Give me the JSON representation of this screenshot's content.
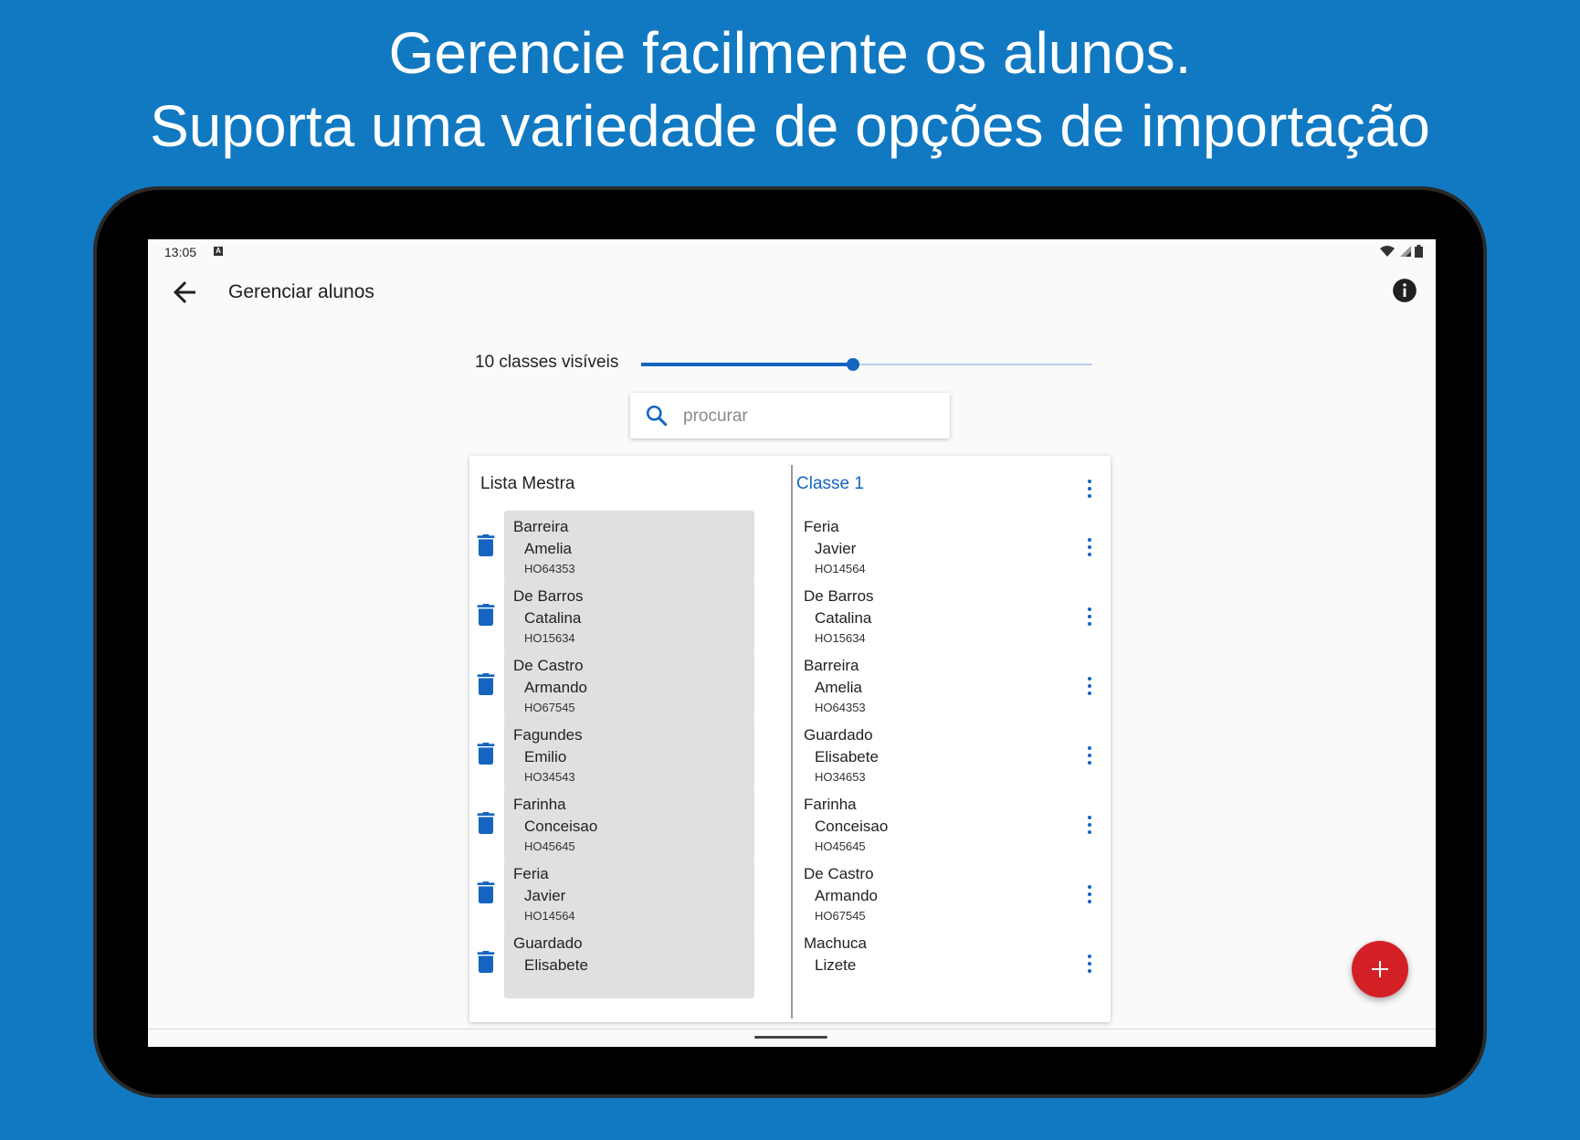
{
  "headline": {
    "line1": "Gerencie facilmente os alunos.",
    "line2": "Suporta uma variedade de opções de importação"
  },
  "status_bar": {
    "time": "13:05",
    "notification_letter": "A"
  },
  "toolbar": {
    "title": "Gerenciar alunos"
  },
  "slider": {
    "label": "10 classes visíveis",
    "value_fraction": 0.47
  },
  "search": {
    "placeholder": "procurar",
    "value": ""
  },
  "master_list": {
    "title": "Lista Mestra",
    "students": [
      {
        "last": "Barreira",
        "first": "Amelia",
        "id": "HO64353"
      },
      {
        "last": "De Barros",
        "first": "Catalina",
        "id": "HO15634"
      },
      {
        "last": "De Castro",
        "first": "Armando",
        "id": "HO67545"
      },
      {
        "last": "Fagundes",
        "first": "Emilio",
        "id": "HO34543"
      },
      {
        "last": "Farinha",
        "first": "Conceisao",
        "id": "HO45645"
      },
      {
        "last": "Feria",
        "first": "Javier",
        "id": "HO14564"
      },
      {
        "last": "Guardado",
        "first": "Elisabete",
        "id": ""
      }
    ]
  },
  "class_list": {
    "title": "Classe 1",
    "students": [
      {
        "last": "Feria",
        "first": "Javier",
        "id": "HO14564"
      },
      {
        "last": "De Barros",
        "first": "Catalina",
        "id": "HO15634"
      },
      {
        "last": "Barreira",
        "first": "Amelia",
        "id": "HO64353"
      },
      {
        "last": "Guardado",
        "first": "Elisabete",
        "id": "HO34653"
      },
      {
        "last": "Farinha",
        "first": "Conceisao",
        "id": "HO45645"
      },
      {
        "last": "De Castro",
        "first": "Armando",
        "id": "HO67545"
      },
      {
        "last": "Machuca",
        "first": "Lizete",
        "id": ""
      }
    ]
  },
  "colors": {
    "background": "#1179c2",
    "accent": "#1565c0",
    "fab": "#d32027",
    "item_bg": "#e0e0e0"
  },
  "icons": {
    "back": "arrow-left-icon",
    "info": "info-icon",
    "search": "search-icon",
    "trash": "trash-icon",
    "menu": "more-vert-icon",
    "fab": "plus-icon"
  }
}
